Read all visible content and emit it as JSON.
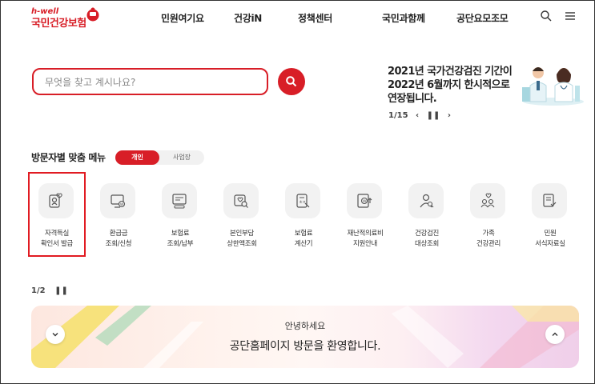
{
  "header": {
    "logo_top": "h-well",
    "logo_name": "국민건강보험",
    "nav": [
      "민원여기요",
      "건강iN",
      "정책센터",
      "국민과함께",
      "공단요모조모"
    ]
  },
  "search": {
    "placeholder": "무엇을 찾고 계시나요?"
  },
  "notice": {
    "lines": [
      "2021년 국가건강검진 기간이",
      "2022년 6월까지 한시적으로",
      "연장됩니다."
    ],
    "pager": "1/15"
  },
  "menu_section": {
    "title": "방문자별 맞춤 메뉴",
    "toggle": {
      "active": "개인",
      "inactive": "사업장"
    },
    "items": [
      {
        "line1": "자격득실",
        "line2": "확인서 발급",
        "icon": "certificate-icon"
      },
      {
        "line1": "환급금",
        "line2": "조회/신청",
        "icon": "refund-monitor-icon"
      },
      {
        "line1": "보험료",
        "line2": "조회/납부",
        "icon": "premium-screen-icon"
      },
      {
        "line1": "본인부담",
        "line2": "상한액조회",
        "icon": "ceiling-search-icon"
      },
      {
        "line1": "보험료",
        "line2": "계산기",
        "icon": "calculator-icon"
      },
      {
        "line1": "재난적의료비",
        "line2": "지원안내",
        "icon": "medical-support-icon"
      },
      {
        "line1": "건강검진",
        "line2": "대상조회",
        "icon": "checkup-people-icon"
      },
      {
        "line1": "가족",
        "line2": "건강관리",
        "icon": "family-icon"
      },
      {
        "line1": "민원",
        "line2": "서식자료실",
        "icon": "form-document-icon"
      }
    ],
    "pager": "1/2"
  },
  "banner": {
    "title": "안녕하세요",
    "subtitle": "공단홈페이지 방문을 환영합니다."
  },
  "colors": {
    "brand": "#d81e27",
    "icon_bg": "#f2f2f2"
  }
}
